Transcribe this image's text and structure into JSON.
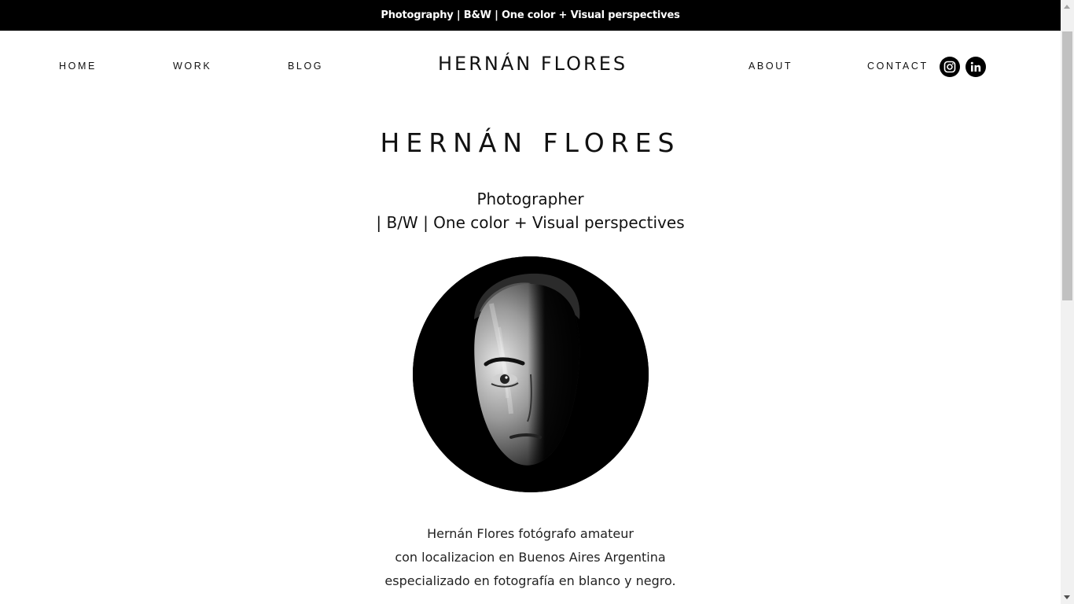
{
  "announcement": "Photography | B&W | One color + Visual perspectives",
  "nav": {
    "home": "HOME",
    "work": "WORK",
    "blog": "BLOG",
    "brand": "HERNÁN FLORES",
    "about": "ABOUT",
    "contact": "CONTACT",
    "social": [
      "instagram-icon",
      "linkedin-icon"
    ]
  },
  "hero": {
    "title": "HERNÁN FLORES",
    "subtitle_line1": "Photographer",
    "subtitle_line2": "| B/W | One color + Visual perspectives"
  },
  "bio": {
    "line1": "Hernán Flores fotógrafo amateur",
    "line2": "con localizacion en Buenos Aires Argentina",
    "line3": "especializado en fotografía en blanco y negro."
  },
  "colors": {
    "topbar": "#000000",
    "background": "#ffffff",
    "text": "#111111"
  }
}
